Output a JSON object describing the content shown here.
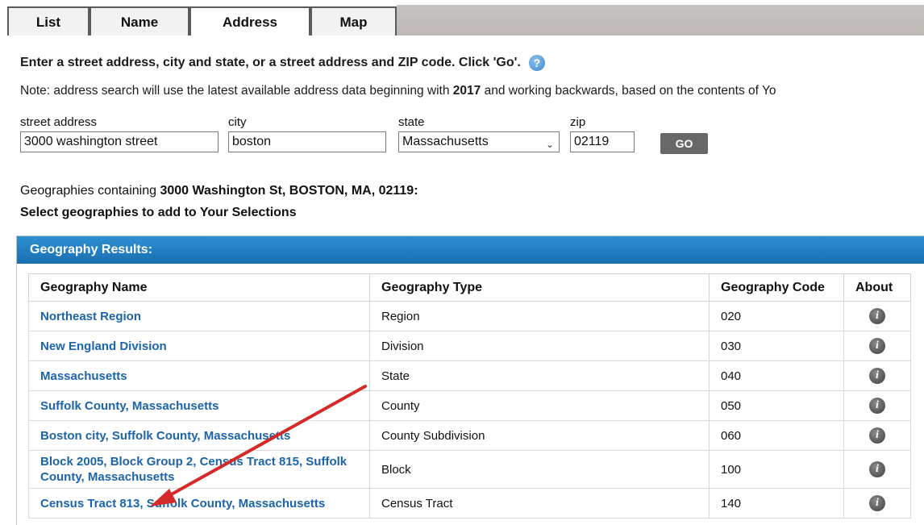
{
  "tabs": [
    {
      "label": "List"
    },
    {
      "label": "Name"
    },
    {
      "label": "Address",
      "active": true
    },
    {
      "label": "Map"
    }
  ],
  "instructions": "Enter a street address, city and state, or a street address and ZIP code. Click 'Go'.",
  "note": {
    "prefix": "Note: address search will use the latest available address data beginning with ",
    "year": "2017",
    "suffix": " and working backwards, based on the contents of Yo"
  },
  "form": {
    "street_label": "street address",
    "street_value": "3000 washington street",
    "city_label": "city",
    "city_value": "boston",
    "state_label": "state",
    "state_value": "Massachusetts",
    "zip_label": "zip",
    "zip_value": "02119",
    "go_label": "GO"
  },
  "geographies": {
    "prefix": "Geographies containing ",
    "address": "3000 Washington St, BOSTON, MA, 02119:",
    "select_text": "Select geographies to add to Your Selections"
  },
  "results": {
    "header": "Geography Results:",
    "columns": [
      "Geography Name",
      "Geography Type",
      "Geography Code",
      "About"
    ],
    "rows": [
      {
        "name": "Northeast Region",
        "type": "Region",
        "code": "020"
      },
      {
        "name": "New England Division",
        "type": "Division",
        "code": "030"
      },
      {
        "name": "Massachusetts",
        "type": "State",
        "code": "040"
      },
      {
        "name": "Suffolk County, Massachusetts",
        "type": "County",
        "code": "050"
      },
      {
        "name": "Boston city, Suffolk County, Massachusetts",
        "type": "County Subdivision",
        "code": "060"
      },
      {
        "name": "Block 2005, Block Group 2, Census Tract 815, Suffolk County, Massachusetts",
        "type": "Block",
        "code": "100"
      },
      {
        "name": "Census Tract 813, Suffolk County, Massachusetts",
        "type": "Census Tract",
        "code": "140"
      }
    ]
  },
  "colors": {
    "accent": "#1a6fb2",
    "link": "#1b64ad",
    "annotation_arrow": "#d42a2a"
  },
  "icons": {
    "help": "help-question-icon",
    "info": "info-icon",
    "dropdown": "chevron-down-icon"
  }
}
